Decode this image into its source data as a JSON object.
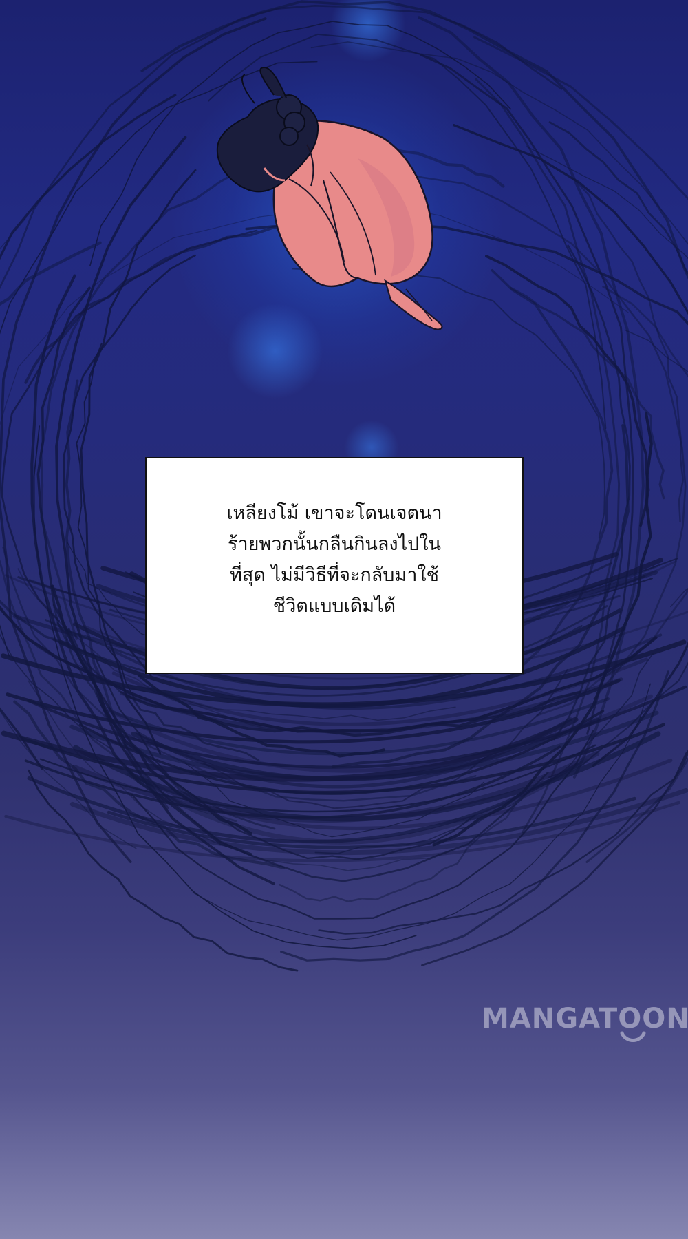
{
  "caption": {
    "lines": [
      "เหลียงโม้ เขาจะโดนเจตนา",
      "ร้ายพวกนั้นกลืนกินลงไปใน",
      "ที่สุด ไม่มีวิธีที่จะกลับมาใช้",
      "ชีวิตแบบเดิมได้"
    ]
  },
  "watermark": {
    "text": "MANGATOON"
  },
  "illustration": {
    "subject": "figure-curled-floating-icon",
    "colors": {
      "background_top": "#1c2270",
      "background_bottom": "#8686b0",
      "skin": "#e88a8a",
      "hair": "#1a1d3c",
      "strands": "#0e1438",
      "glow": "#2f7be8"
    }
  }
}
